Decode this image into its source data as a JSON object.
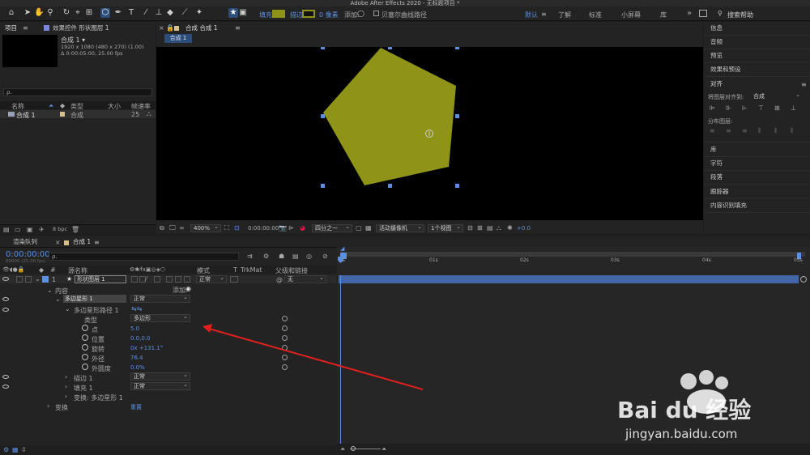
{
  "window_title": "Adobe After Effects 2020 - 无标题项目 *",
  "toolbar": {
    "fill_label": "填充:",
    "stroke_label": "描边:",
    "stroke_width": "0 像素",
    "add_label": "添加:",
    "bezier_label": "贝塞尔曲线路径",
    "workspaces": [
      "默认",
      "了解",
      "标准",
      "小屏幕",
      "库"
    ],
    "more": "»",
    "search_placeholder": "搜索帮助",
    "fill_color": "#8f9418",
    "stroke_color": "#8f9418",
    "accent": "#5b8fe0"
  },
  "project_panel": {
    "tab": "项目",
    "effects_tab": "效果控件 形状图层 1",
    "comp_name": "合成 1 ▾",
    "comp_res": "1920 x 1080  (480 x 270) (1.00)",
    "comp_dur": "Δ 0:00:05:00, 25.00 fps",
    "search_icon": "ρ.",
    "columns": [
      "名称",
      "类型",
      "大小",
      "帧速率"
    ],
    "items": [
      {
        "name": "合成 1",
        "type": "合成",
        "size": "",
        "fps": "25"
      }
    ],
    "bpc": "8 bpc"
  },
  "viewer": {
    "tab": "合成 合成 1",
    "subtab": "合成 1",
    "zoom": "400%",
    "timecode": "0:00:00:00",
    "resolution": "四分之一",
    "camera": "活动摄像机",
    "views": "1个视图",
    "exposure": "+0.0",
    "shape_color": "#8f9418"
  },
  "right_panel": {
    "items_top": [
      "信息",
      "音频",
      "预览",
      "效果和预设"
    ],
    "align_title": "对齐",
    "align_to_label": "将图层对齐到:",
    "align_to_value": "合成",
    "distribute_label": "分布图层:",
    "items_bottom": [
      "库",
      "字符",
      "段落",
      "跟踪器",
      "内容识别填充"
    ]
  },
  "timeline": {
    "tab_render": "渲染队列",
    "tab_comp": "合成 1",
    "timecode": "0:00:00:00",
    "timecode_sub": "00000 (25.00 fps)",
    "columns": {
      "source": "源名称",
      "mode": "模式",
      "t": "T",
      "trkmat": "TrkMat",
      "parent": "父级和链接"
    },
    "layer": {
      "num": "1",
      "name": "形状图层 1",
      "mode": "正常",
      "parent": "无"
    },
    "rows": {
      "contents": "内容",
      "add": "添加:",
      "polystar": "多边星形 1",
      "polystar_mode": "正常",
      "polypath": "多边星形路径 1",
      "type_label": "类型",
      "type_value": "多边形",
      "points_label": "点",
      "points_value": "5.0",
      "position_label": "位置",
      "position_value": "0.0,0.0",
      "rotation_label": "旋转",
      "rotation_value": "0x +131.1°",
      "outer_radius_label": "外径",
      "outer_radius_value": "76.4",
      "outer_round_label": "外圆度",
      "outer_round_value": "0.0%",
      "stroke": "描边 1",
      "stroke_mode": "正常",
      "fill": "填充 1",
      "fill_mode": "正常",
      "transform_poly": "变换: 多边星形 1",
      "transform": "变换",
      "reset": "重置"
    },
    "ruler": [
      "0s",
      "01s",
      "02s",
      "03s",
      "04s",
      "05s"
    ]
  },
  "watermark": {
    "brand": "Bai du 经验",
    "url": "jingyan.baidu.com"
  }
}
